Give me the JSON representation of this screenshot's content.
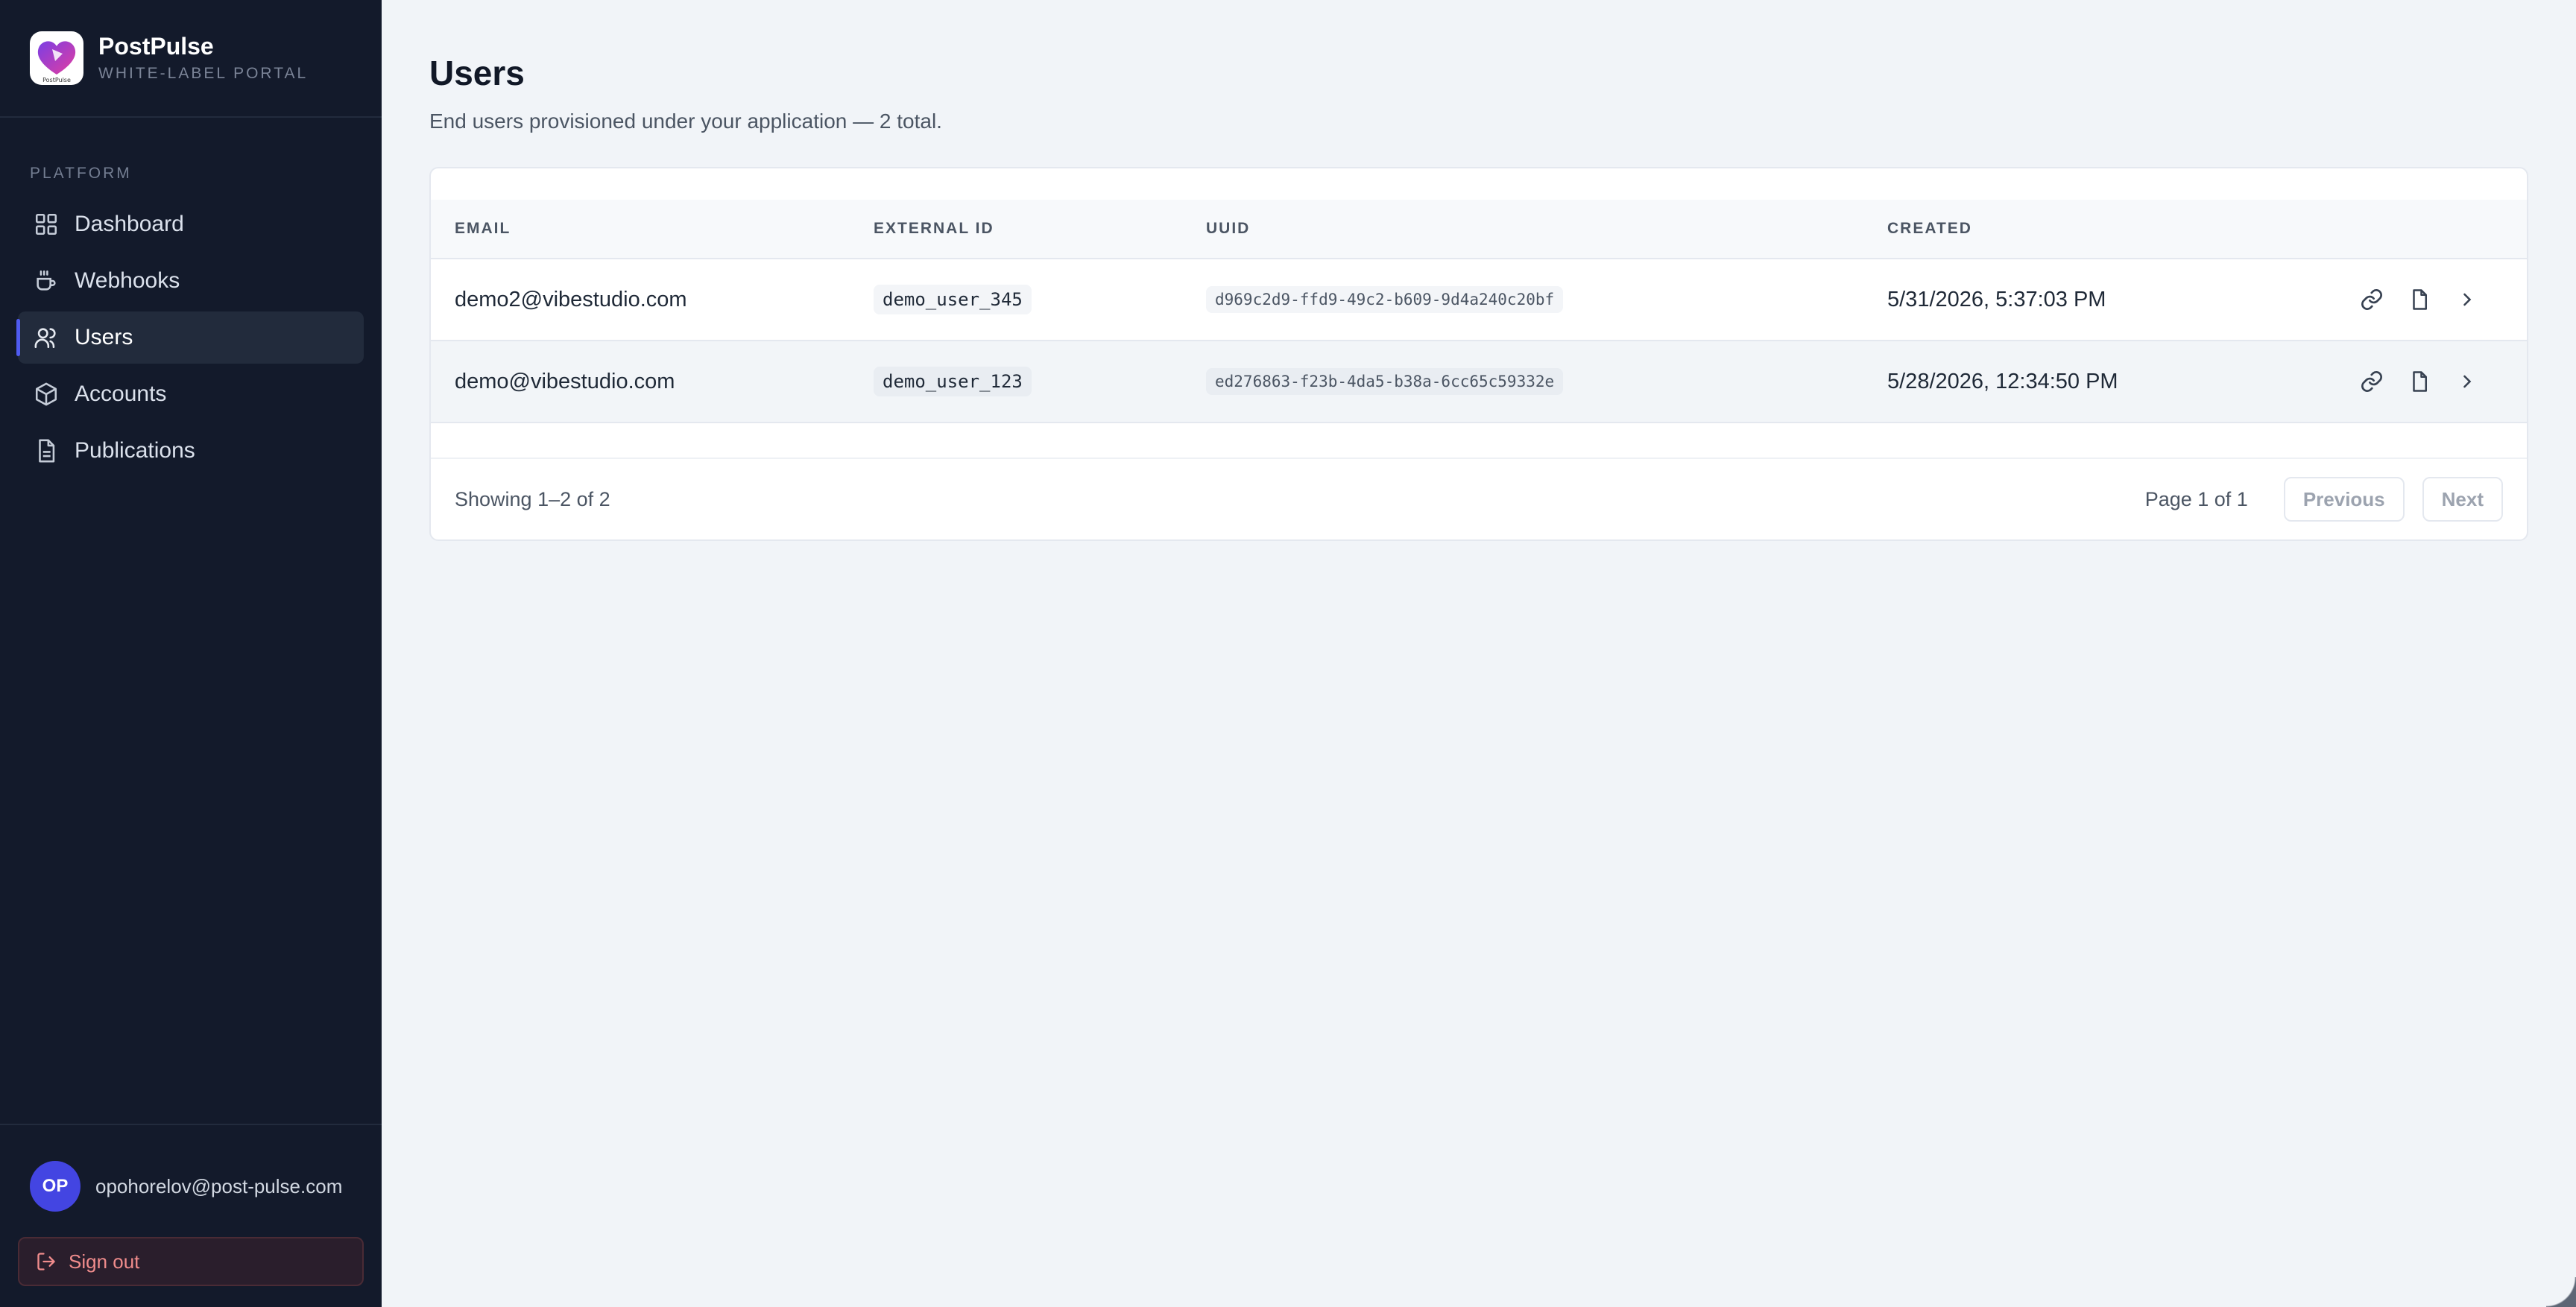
{
  "brand": {
    "name": "PostPulse",
    "subtitle": "WHITE-LABEL PORTAL",
    "logo_text": "PostPulse"
  },
  "sidebar": {
    "section_label": "PLATFORM",
    "items": [
      {
        "label": "Dashboard",
        "icon": "grid-icon"
      },
      {
        "label": "Webhooks",
        "icon": "cup-icon"
      },
      {
        "label": "Users",
        "icon": "users-icon",
        "active": true
      },
      {
        "label": "Accounts",
        "icon": "box-icon"
      },
      {
        "label": "Publications",
        "icon": "document-icon"
      }
    ],
    "user": {
      "initials": "OP",
      "email": "opohorelov@post-pulse.com"
    },
    "signout_label": "Sign out"
  },
  "page": {
    "title": "Users",
    "subtitle": "End users provisioned under your application — 2 total."
  },
  "table": {
    "columns": [
      "EMAIL",
      "EXTERNAL ID",
      "UUID",
      "CREATED"
    ],
    "rows": [
      {
        "email": "demo2@vibestudio.com",
        "external_id": "demo_user_345",
        "uuid": "d969c2d9-ffd9-49c2-b609-9d4a240c20bf",
        "created": "5/31/2026, 5:37:03 PM"
      },
      {
        "email": "demo@vibestudio.com",
        "external_id": "demo_user_123",
        "uuid": "ed276863-f23b-4da5-b38a-6cc65c59332e",
        "created": "5/28/2026, 12:34:50 PM"
      }
    ],
    "footer": {
      "showing": "Showing 1–2 of 2",
      "page_info": "Page 1 of 1",
      "previous": "Previous",
      "next": "Next"
    }
  },
  "colors": {
    "sidebar_bg": "#131a2b",
    "accent": "#4f5bf0",
    "avatar_bg": "#4345e2",
    "signout_text": "#f08c8c",
    "page_bg": "#f1f4f8"
  }
}
